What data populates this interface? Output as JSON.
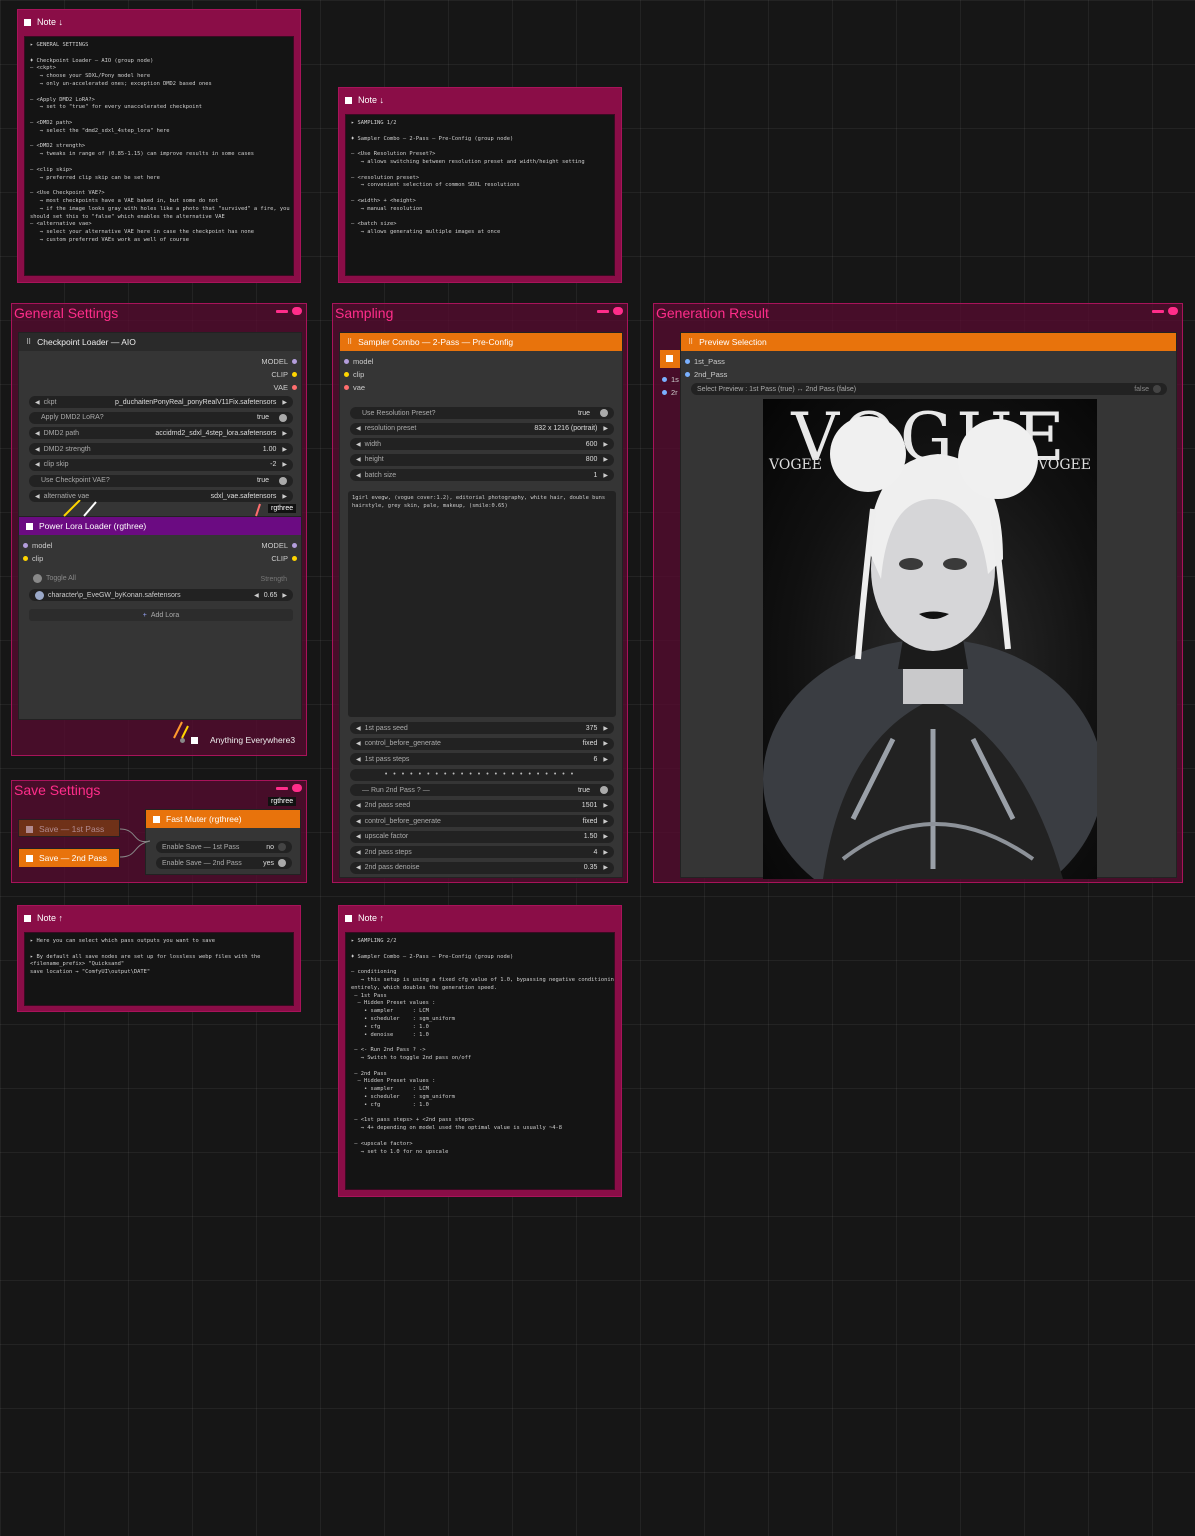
{
  "notes": {
    "top_left": {
      "title": "Note ↓",
      "body": "▸ GENERAL SETTINGS\n\n♦ Checkpoint Loader — AIO (group node)\n— <ckpt>\n   → choose your SDXL/Pony model here\n   → only un-accelerated ones; exception DMD2 based ones\n\n— <Apply DMD2 LoRA?>\n   → set to \"true\" for every unaccelerated checkpoint\n\n— <DMD2 path>\n   → select the \"dmd2_sdxl_4step_lora\" here\n\n— <DMD2 strength>\n   → tweaks in range of (0.85-1.15) can improve results in some cases\n\n— <clip skip>\n   → preferred clip skip can be set here\n\n— <Use Checkpoint VAE?>\n   → most checkpoints have a VAE baked in, but some do not\n   → if the image looks gray with holes like a photo that \"survived\" a fire, you\nshould set this to \"false\" which enables the alternative VAE\n— <alternative vae>\n   → select your alternative VAE here in case the checkpoint has none\n   → custom preferred VAEs work as well of course"
    },
    "top_mid": {
      "title": "Note ↓",
      "body": "▸ SAMPLING 1/2\n\n♦ Sampler Combo — 2-Pass — Pre-Config (group node)\n\n— <Use Resolution Preset?>\n   → allows switching between resolution preset and width/height setting\n\n— <resolution preset>\n   → convenient selection of common SDXL resolutions\n\n— <width> + <height>\n   → manual resolution\n\n— <batch size>\n   → allows generating multiple images at once"
    },
    "bottom_left": {
      "title": "Note ↑",
      "body": "▸ Here you can select which pass outputs you want to save\n\n▸ By default all save nodes are set up for lossless webp files with the\n<filename_prefix> \"Quicksand\"\nsave location → \"ComfyUI\\output\\DATE\""
    },
    "bottom_mid": {
      "title": "Note ↑",
      "body": "▸ SAMPLING 2/2\n\n♦ Sampler Combo — 2-Pass — Pre-Config (group node)\n\n— conditioning\n   → this setup is using a fixed cfg value of 1.0, bypassing negative conditioning\nentirely, which doubles the generation speed.\n — 1st Pass\n  — Hidden Preset values :\n    • sampler      : LCM\n    • scheduler    : sgm_uniform\n    • cfg          : 1.0\n    • denoise      : 1.0\n\n — <- Run 2nd Pass ? ->\n   → Switch to toggle 2nd pass on/off\n\n — 2nd Pass\n  — Hidden Preset values :\n    • sampler      : LCM\n    • scheduler    : sgm_uniform\n    • cfg          : 1.0\n\n — <1st pass steps> + <2nd pass steps>\n   → 4+ depending on model used the optimal value is usually ~4-8\n\n — <upscale factor>\n   → set to 1.0 for no upscale"
    }
  },
  "groups": {
    "general": "General Settings",
    "sampling": "Sampling",
    "result": "Generation Result",
    "save": "Save Settings"
  },
  "checkpoint": {
    "title": "Checkpoint Loader — AIO",
    "outputs": [
      "MODEL",
      "CLIP",
      "VAE"
    ],
    "widgets": [
      {
        "label": "ckpt",
        "value": "p_duchaitenPonyReal_ponyRealV11Fix.safetensors",
        "type": "combo"
      },
      {
        "label": "Apply DMD2 LoRA?",
        "value": "true",
        "type": "toggle"
      },
      {
        "label": "DMD2 path",
        "value": "accidmd2_sdxl_4step_lora.safetensors",
        "type": "combo"
      },
      {
        "label": "DMD2 strength",
        "value": "1.00",
        "type": "number"
      },
      {
        "label": "clip skip",
        "value": "-2",
        "type": "number"
      },
      {
        "label": "Use Checkpoint VAE?",
        "value": "true",
        "type": "toggle"
      },
      {
        "label": "alternative vae",
        "value": "sdxl_vae.safetensors",
        "type": "combo"
      }
    ],
    "badge": "rgthree"
  },
  "power_lora": {
    "title": "Power Lora Loader (rgthree)",
    "in_model": "model",
    "in_clip": "clip",
    "out_model": "MODEL",
    "out_clip": "CLIP",
    "toggle_all": "Toggle All",
    "strength_label": "Strength",
    "lora_name": "character\\p_EveGW_byKonan.safetensors",
    "lora_strength": "0.65",
    "add_lora": "Add Lora"
  },
  "anything": {
    "title": "Anything Everywhere3"
  },
  "sampler": {
    "title": "Sampler Combo — 2-Pass — Pre-Config",
    "inputs": [
      "model",
      "clip",
      "vae"
    ],
    "top_widgets": [
      {
        "label": "Use Resolution Preset?",
        "value": "true",
        "type": "toggle"
      },
      {
        "label": "resolution preset",
        "value": "832 x 1216  (portrait)",
        "type": "combo"
      },
      {
        "label": "width",
        "value": "600",
        "type": "number"
      },
      {
        "label": "height",
        "value": "800",
        "type": "number"
      },
      {
        "label": "batch size",
        "value": "1",
        "type": "number"
      }
    ],
    "prompt": "1girl evegw, (vogue cover:1.2), editorial photography, white hair, double buns\nhairstyle, grey skin, pale, makeup, (smile:0.65)",
    "bottom_widgets": [
      {
        "label": "1st pass seed",
        "value": "375",
        "type": "number"
      },
      {
        "label": "control_before_generate",
        "value": "fixed",
        "type": "combo"
      },
      {
        "label": "1st pass steps",
        "value": "6",
        "type": "number"
      },
      {
        "label": "",
        "value": "",
        "type": "divider"
      },
      {
        "label": "— Run 2nd Pass ? —",
        "value": "true",
        "type": "toggle"
      },
      {
        "label": "2nd pass seed",
        "value": "1501",
        "type": "number"
      },
      {
        "label": "control_before_generate",
        "value": "fixed",
        "type": "combo"
      },
      {
        "label": "upscale factor",
        "value": "1.50",
        "type": "number"
      },
      {
        "label": "2nd pass steps",
        "value": "4",
        "type": "number"
      },
      {
        "label": "2nd pass denoise",
        "value": "0.35",
        "type": "number"
      }
    ]
  },
  "preview": {
    "title": "Preview Selection",
    "inputs": [
      "1st_Pass",
      "2nd_Pass"
    ],
    "side_inputs": [
      "1s",
      "2r"
    ],
    "select_label": "Select Preview : 1st Pass (true) ↔ 2nd Pass (false)",
    "select_value": "false",
    "image": {
      "masthead": "VOGUE",
      "masthead_small_left": "VOGEE",
      "masthead_small_right": "VOGEE"
    }
  },
  "save": {
    "save1": "Save — 1st Pass",
    "save2": "Save — 2nd Pass",
    "muter_title": "Fast Muter (rgthree)",
    "badge": "rgthree",
    "enable1": {
      "label": "Enable Save — 1st Pass",
      "value": "no"
    },
    "enable2": {
      "label": "Enable Save — 2nd Pass",
      "value": "yes"
    }
  },
  "colors": {
    "accent": "#ff2d8a",
    "orange": "#e8730c",
    "purple": "#6b0b82",
    "note": "#8a0d47"
  }
}
